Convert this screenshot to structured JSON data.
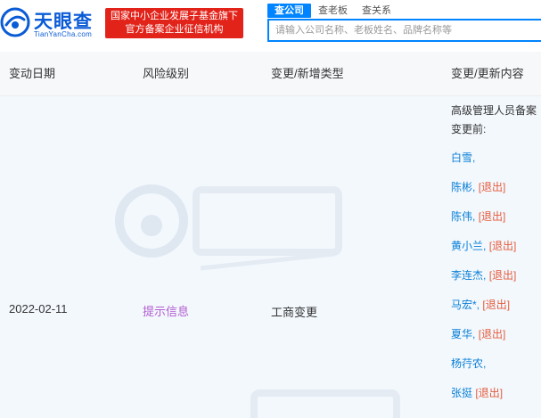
{
  "brand": {
    "name": "天眼查",
    "sub": "TianYanCha.com",
    "badge_line1": "国家中小企业发展子基金旗下",
    "badge_line2": "官方备案企业征信机构",
    "color": "#0a5bd6",
    "badge_color": "#e2231a"
  },
  "search": {
    "tabs": [
      "查公司",
      "查老板",
      "查关系"
    ],
    "active_tab": 0,
    "placeholder": "请输入公司名称、老板姓名、品牌名称等"
  },
  "table": {
    "headers": [
      "变动日期",
      "风险级别",
      "变更/新增类型",
      "变更/更新内容"
    ],
    "row": {
      "date": "2022-02-11",
      "risk": "提示信息",
      "type": "工商变更",
      "content_title": "高级管理人员备案",
      "content_before": "变更前:",
      "persons": [
        {
          "name": "白雪,",
          "quit": ""
        },
        {
          "name": "陈彬,",
          "quit": "[退出]"
        },
        {
          "name": "陈伟,",
          "quit": "[退出]"
        },
        {
          "name": "黄小兰,",
          "quit": "[退出]"
        },
        {
          "name": "李连杰,",
          "quit": "[退出]"
        },
        {
          "name": "马宏*,",
          "quit": "[退出]"
        },
        {
          "name": "夏华,",
          "quit": "[退出]"
        },
        {
          "name": "杨荇农,",
          "quit": ""
        },
        {
          "name": "张挺",
          "quit": "[退出]"
        }
      ]
    },
    "colors": {
      "risk": "#b25dd1",
      "name": "#0a7fd6",
      "quit": "#e55b3c"
    }
  }
}
